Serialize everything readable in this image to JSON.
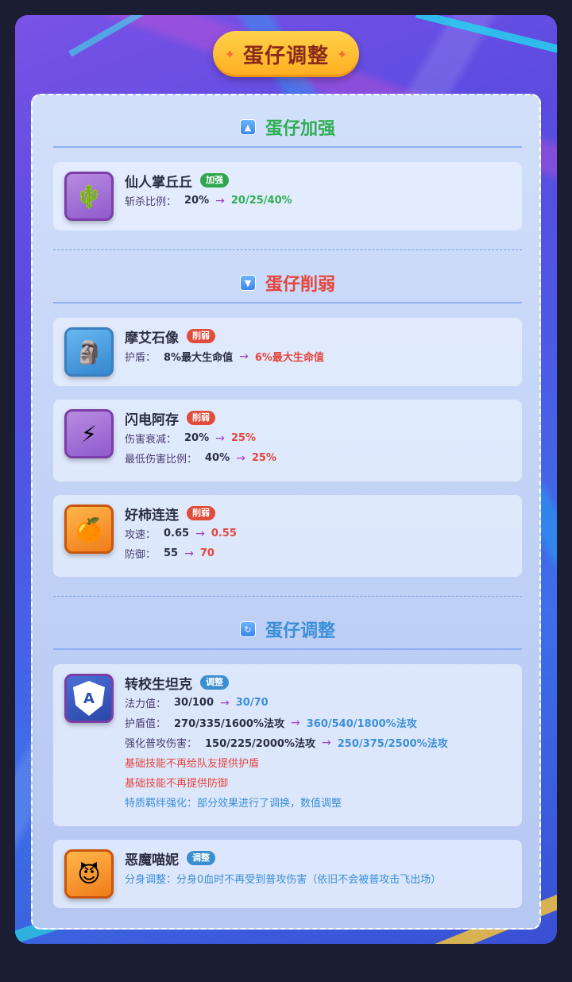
{
  "title": "蛋仔调整",
  "sections": {
    "buff": {
      "title": "蛋仔加强",
      "icon": "▲"
    },
    "nerf": {
      "title": "蛋仔削弱",
      "icon": "▼"
    },
    "adjust": {
      "title": "蛋仔调整",
      "icon": "↻"
    }
  },
  "cards": [
    {
      "name": "仙人掌丘丘",
      "badge": "加强",
      "lines": [
        {
          "label": "斩杀比例：",
          "old": "20%",
          "new": "20/25/40%"
        }
      ]
    },
    {
      "name": "摩艾石像",
      "badge": "削弱",
      "lines": [
        {
          "label": "护盾：",
          "old": "8%最大生命值",
          "new": "6%最大生命值"
        }
      ]
    },
    {
      "name": "闪电阿存",
      "badge": "削弱",
      "lines": [
        {
          "label": "伤害衰减：",
          "old": "20%",
          "new": "25%"
        },
        {
          "label": "最低伤害比例：",
          "old": "40%",
          "new": "25%"
        }
      ]
    },
    {
      "name": "好柿连连",
      "badge": "削弱",
      "lines": [
        {
          "label": "攻速：",
          "old": "0.65",
          "new": "0.55"
        },
        {
          "label": "防御：",
          "old": "55",
          "new": "70"
        }
      ]
    },
    {
      "name": "转校生坦克",
      "badge": "调整",
      "lines": [
        {
          "label": "法力值：",
          "old": "30/100",
          "new": "30/70"
        },
        {
          "label": "护盾值：",
          "old": "270/335/1600%法攻",
          "new": "360/540/1800%法攻"
        },
        {
          "label": "强化普攻伤害：",
          "old": "150/225/2000%法攻",
          "new": "250/375/2500%法攻"
        }
      ],
      "notes_red": [
        "基础技能不再给队友提供护盾",
        "基础技能不再提供防御"
      ],
      "notes_blue": [
        "特质羁绊强化：部分效果进行了调换，数值调整"
      ]
    },
    {
      "name": "恶魔喵妮",
      "badge": "调整",
      "notes_blue": [
        "分身调整：分身0血时不再受到普攻伤害（依旧不会被普攻击飞出场）"
      ]
    }
  ],
  "arrow": "→",
  "icons": {
    "title_spark": "✦"
  }
}
